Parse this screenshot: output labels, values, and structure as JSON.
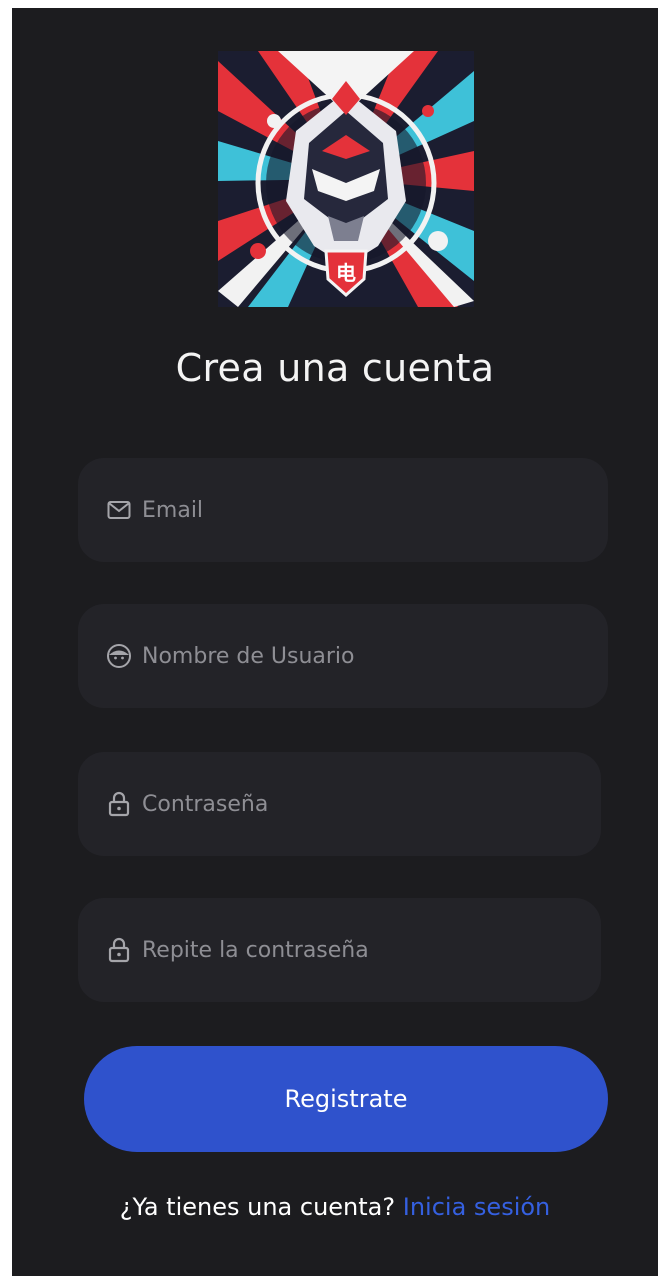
{
  "title": "Crea una cuenta",
  "fields": {
    "email": {
      "placeholder": "Email",
      "value": "",
      "icon": "mail-icon"
    },
    "username": {
      "placeholder": "Nombre de Usuario",
      "value": "",
      "icon": "user-face-icon"
    },
    "password": {
      "placeholder": "Contraseña",
      "value": "",
      "icon": "lock-icon"
    },
    "confirm_password": {
      "placeholder": "Repite la contraseña",
      "value": "",
      "icon": "lock-icon"
    }
  },
  "register_button": {
    "label": "Registrate"
  },
  "footer": {
    "prompt": "¿Ya tienes una cuenta?",
    "link_label": "Inicia sesión"
  },
  "colors": {
    "background": "#1c1c1f",
    "field_background": "#232328",
    "accent": "#2f52cc",
    "link": "#3560e0"
  }
}
